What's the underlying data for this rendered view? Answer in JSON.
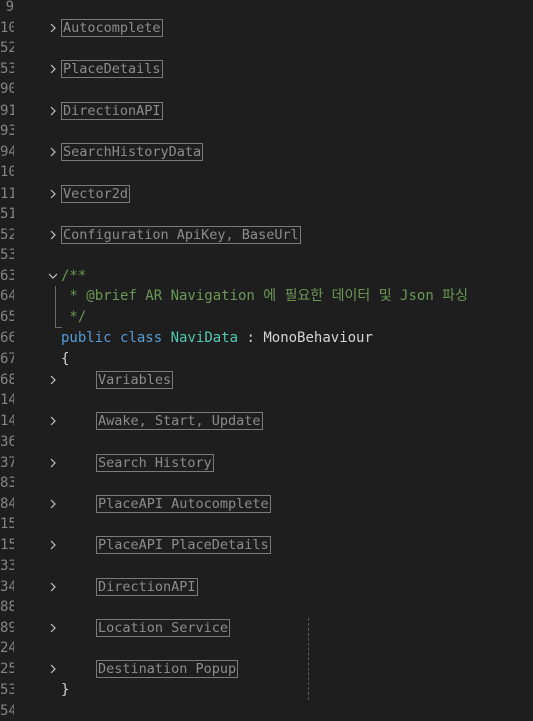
{
  "editor": {
    "line_numbers": [
      "9",
      "10",
      "52",
      "53",
      "90",
      "91",
      "93",
      "94",
      "10",
      "11",
      "51",
      "52",
      "53",
      "63",
      "64",
      "65",
      "66",
      "67",
      "68",
      "14",
      "14",
      "36",
      "37",
      "83",
      "84",
      "15",
      "15",
      "33",
      "34",
      "88",
      "89",
      "24",
      "25",
      "53",
      "54"
    ],
    "fold_blocks": [
      {
        "label": "Autocomplete"
      },
      {
        "label": "PlaceDetails"
      },
      {
        "label": "DirectionAPI"
      },
      {
        "label": "SearchHistoryData"
      },
      {
        "label": "Vector2d"
      },
      {
        "label": "Configuration ApiKey, BaseUrl"
      }
    ],
    "doc_comment": {
      "open": "/**",
      "brief": " * @brief AR Navigation 에 필요한 데이터 및 Json 파싱",
      "close": " */"
    },
    "class_decl": {
      "kw_public": "public",
      "kw_class": "class",
      "name": "NaviData",
      "colon": " : ",
      "base": "MonoBehaviour"
    },
    "open_brace": "{",
    "close_brace": "}",
    "class_regions": [
      {
        "label": "Variables"
      },
      {
        "label": "Awake, Start, Update"
      },
      {
        "label": "Search History"
      },
      {
        "label": "PlaceAPI Autocomplete"
      },
      {
        "label": "PlaceAPI PlaceDetails"
      },
      {
        "label": "DirectionAPI"
      },
      {
        "label": "Location Service"
      },
      {
        "label": "Destination Popup"
      }
    ]
  }
}
